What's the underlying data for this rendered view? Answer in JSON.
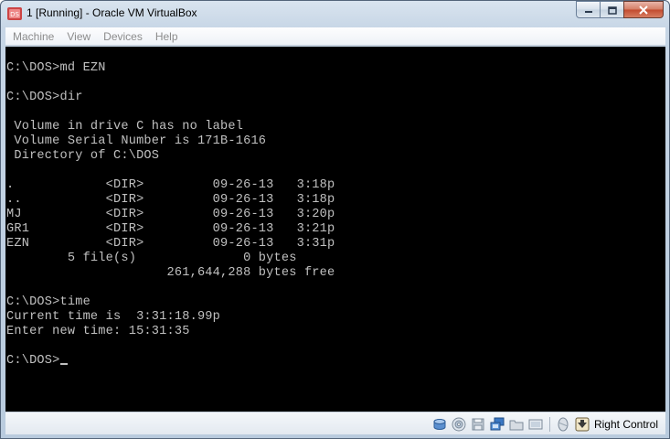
{
  "window": {
    "title": "1 [Running] - Oracle VM VirtualBox"
  },
  "menu": {
    "items": [
      "Machine",
      "View",
      "Devices",
      "Help"
    ]
  },
  "console": {
    "lines": [
      "C:\\DOS>md EZN",
      "",
      "C:\\DOS>dir",
      "",
      " Volume in drive C has no label",
      " Volume Serial Number is 171B-1616",
      " Directory of C:\\DOS",
      "",
      ".            <DIR>         09-26-13   3:18p",
      "..           <DIR>         09-26-13   3:18p",
      "MJ           <DIR>         09-26-13   3:20p",
      "GR1          <DIR>         09-26-13   3:21p",
      "EZN          <DIR>         09-26-13   3:31p",
      "        5 file(s)              0 bytes",
      "                     261,644,288 bytes free",
      "",
      "C:\\DOS>time",
      "Current time is  3:31:18.99p",
      "Enter new time: 15:31:35",
      "",
      "C:\\DOS>"
    ]
  },
  "statusbar": {
    "icons": [
      "hard-disk-icon",
      "cd-icon",
      "floppy-icon",
      "network-icon",
      "shared-folders-icon",
      "display-icon",
      "mouse-integration-icon",
      "host-key-arrow-icon"
    ],
    "host_key_label": "Right Control"
  }
}
